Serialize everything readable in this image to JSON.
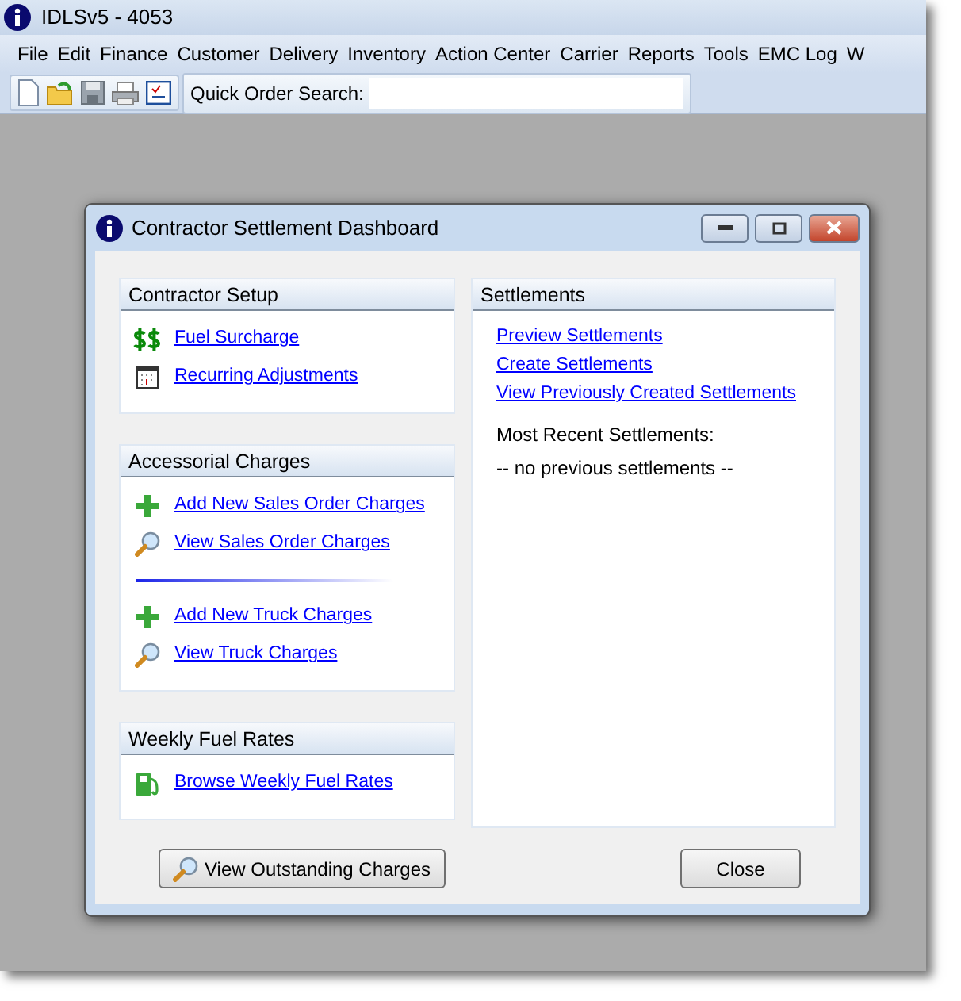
{
  "app": {
    "title": "IDLSv5 - 4053"
  },
  "menu": [
    "File",
    "Edit",
    "Finance",
    "Customer",
    "Delivery",
    "Inventory",
    "Action Center",
    "Carrier",
    "Reports",
    "Tools",
    "EMC Log",
    "W"
  ],
  "toolbar": {
    "search_label": "Quick Order Search:"
  },
  "dialog": {
    "title": "Contractor Settlement Dashboard",
    "left_panels": [
      {
        "title": "Contractor Setup",
        "groups": [
          [
            {
              "kind": "dollar",
              "label": "Fuel Surcharge"
            },
            {
              "kind": "calendar",
              "label": "Recurring Adjustments"
            }
          ]
        ]
      },
      {
        "title": "Accessorial Charges",
        "groups": [
          [
            {
              "kind": "add",
              "label": "Add New Sales Order Charges"
            },
            {
              "kind": "view",
              "label": "View Sales Order Charges"
            }
          ],
          [
            {
              "kind": "add",
              "label": "Add New Truck Charges"
            },
            {
              "kind": "view",
              "label": "View Truck Charges"
            }
          ]
        ]
      },
      {
        "title": "Weekly Fuel Rates",
        "groups": [
          [
            {
              "kind": "fuel",
              "label": "Browse Weekly Fuel Rates"
            }
          ]
        ]
      }
    ],
    "settlements": {
      "title": "Settlements",
      "links": [
        "Preview Settlements",
        "Create Settlements",
        "View Previously Created Settlements"
      ],
      "recent_label": "Most Recent Settlements:",
      "recent_empty": "-- no previous settlements --"
    },
    "outstanding_button": "View Outstanding Charges",
    "close_button": "Close"
  }
}
